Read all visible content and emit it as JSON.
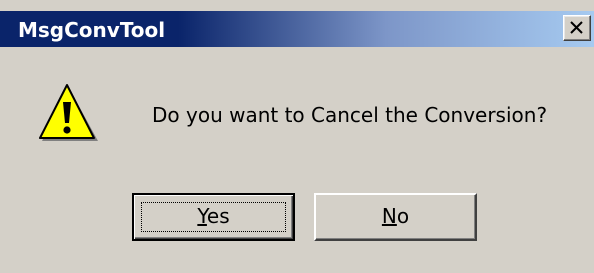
{
  "window": {
    "title": "MsgConvTool",
    "close_icon": "close-icon"
  },
  "dialog": {
    "icon": "warning-icon",
    "message": "Do you want to Cancel the Conversion?"
  },
  "buttons": {
    "yes": {
      "accel": "Y",
      "rest": "es"
    },
    "no": {
      "accel": "N",
      "rest": "o"
    }
  },
  "colors": {
    "titlebar_start": "#0a246a",
    "titlebar_end": "#a6caf0",
    "dialog_face": "#d4d0c8",
    "warning_yellow": "#ffff00"
  }
}
